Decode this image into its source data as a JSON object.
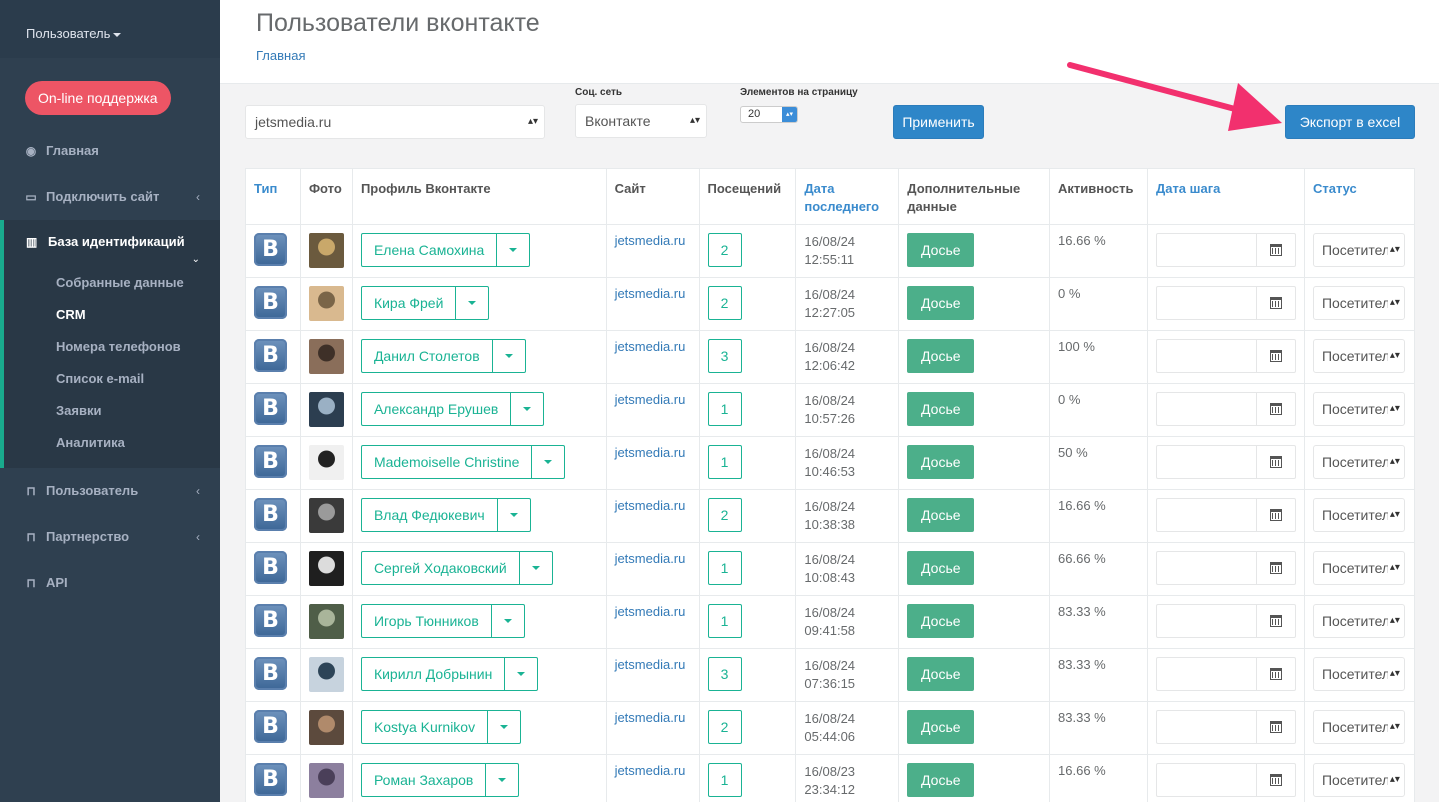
{
  "sidebar": {
    "user_label": "Пользователь",
    "support_button": "On-line поддержка",
    "nav": {
      "home": "Главная",
      "connect": "Подключить сайт",
      "base": "База идентификаций",
      "user": "Пользователь",
      "partner": "Партнерство",
      "api": "API"
    },
    "sub_items": [
      "Собранные данные",
      "CRM",
      "Номера телефонов",
      "Список e-mail",
      "Заявки",
      "Аналитика"
    ]
  },
  "header": {
    "title": "Пользователи вконтакте",
    "breadcrumb": "Главная"
  },
  "filters": {
    "site_value": "jetsmedia.ru",
    "network_label": "Соц. сеть",
    "network_value": "Вконтакте",
    "per_page_label": "Элементов на страницу",
    "per_page_value": "20",
    "apply_button": "Применить",
    "export_button": "Экспорт в excel"
  },
  "table": {
    "columns": {
      "type": "Тип",
      "photo": "Фото",
      "profile": "Профиль Вконтакте",
      "site": "Сайт",
      "visits": "Посещений",
      "last_date_1": "Дата",
      "last_date_2": "последнего",
      "extra_1": "Дополнительные",
      "extra_2": "данные",
      "activity": "Активность",
      "step_date": "Дата шага",
      "status": "Статус"
    },
    "dossier_label": "Досье",
    "status_value": "Посетитель",
    "rows": [
      {
        "name": "Елена Самохина",
        "site": "jetsmedia.ru",
        "visits": "2",
        "date": "16/08/24",
        "time": "12:55:11",
        "activity": "16.66 %"
      },
      {
        "name": "Кира Фрей",
        "site": "jetsmedia.ru",
        "visits": "2",
        "date": "16/08/24",
        "time": "12:27:05",
        "activity": "0 %"
      },
      {
        "name": "Данил Столетов",
        "site": "jetsmedia.ru",
        "visits": "3",
        "date": "16/08/24",
        "time": "12:06:42",
        "activity": "100 %"
      },
      {
        "name": "Александр Ерушев",
        "site": "jetsmedia.ru",
        "visits": "1",
        "date": "16/08/24",
        "time": "10:57:26",
        "activity": "0 %"
      },
      {
        "name": "Mademoiselle Christine",
        "site": "jetsmedia.ru",
        "visits": "1",
        "date": "16/08/24",
        "time": "10:46:53",
        "activity": "50 %"
      },
      {
        "name": "Влад Федюкевич",
        "site": "jetsmedia.ru",
        "visits": "2",
        "date": "16/08/24",
        "time": "10:38:38",
        "activity": "16.66 %"
      },
      {
        "name": "Сергей Ходаковский",
        "site": "jetsmedia.ru",
        "visits": "1",
        "date": "16/08/24",
        "time": "10:08:43",
        "activity": "66.66 %"
      },
      {
        "name": "Игорь Тюнников",
        "site": "jetsmedia.ru",
        "visits": "1",
        "date": "16/08/24",
        "time": "09:41:58",
        "activity": "83.33 %"
      },
      {
        "name": "Кирилл Добрынин",
        "site": "jetsmedia.ru",
        "visits": "3",
        "date": "16/08/24",
        "time": "07:36:15",
        "activity": "83.33 %"
      },
      {
        "name": "Kostya Kurnikov",
        "site": "jetsmedia.ru",
        "visits": "2",
        "date": "16/08/24",
        "time": "05:44:06",
        "activity": "83.33 %"
      },
      {
        "name": "Роман Захаров",
        "site": "jetsmedia.ru",
        "visits": "1",
        "date": "16/08/23",
        "time": "23:34:12",
        "activity": "16.66 %"
      }
    ]
  },
  "colors": {
    "sidebar_bg": "#2f4050",
    "accent_green": "#1ab394",
    "dossier_green": "#4caf8a",
    "primary_blue": "#2e86c8",
    "support_red": "#ed5565",
    "arrow_pink": "#f2306e"
  }
}
